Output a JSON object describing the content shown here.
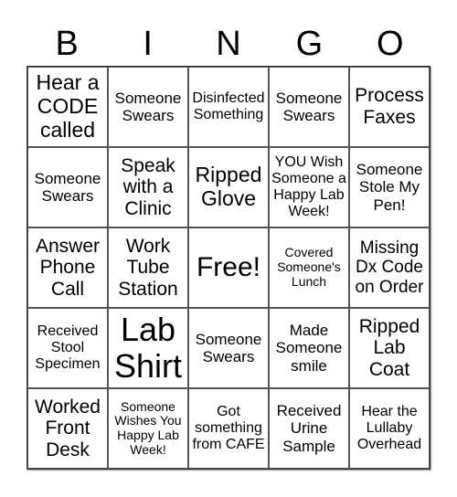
{
  "header": [
    "B",
    "I",
    "N",
    "G",
    "O"
  ],
  "cells": [
    "Hear a CODE called",
    "Someone Swears",
    "Disinfected Something",
    "Someone Swears",
    "Process Faxes",
    "Someone Swears",
    "Speak with a Clinic",
    "Ripped Glove",
    "YOU Wish Someone a Happy Lab Week!",
    "Someone Stole My Pen!",
    "Answer Phone Call",
    "Work Tube Station",
    "Free!",
    "Covered Someone's Lunch",
    "Missing Dx Code on Order",
    "Received Stool Specimen",
    "Lab Shirt",
    "Someone Swears",
    "Made Someone smile",
    "Ripped Lab Coat",
    "Worked Front Desk",
    "Someone Wishes You Happy Lab Week!",
    "Got something from CAFE",
    "Received Urine Sample",
    "Hear the Lullaby Overhead"
  ]
}
